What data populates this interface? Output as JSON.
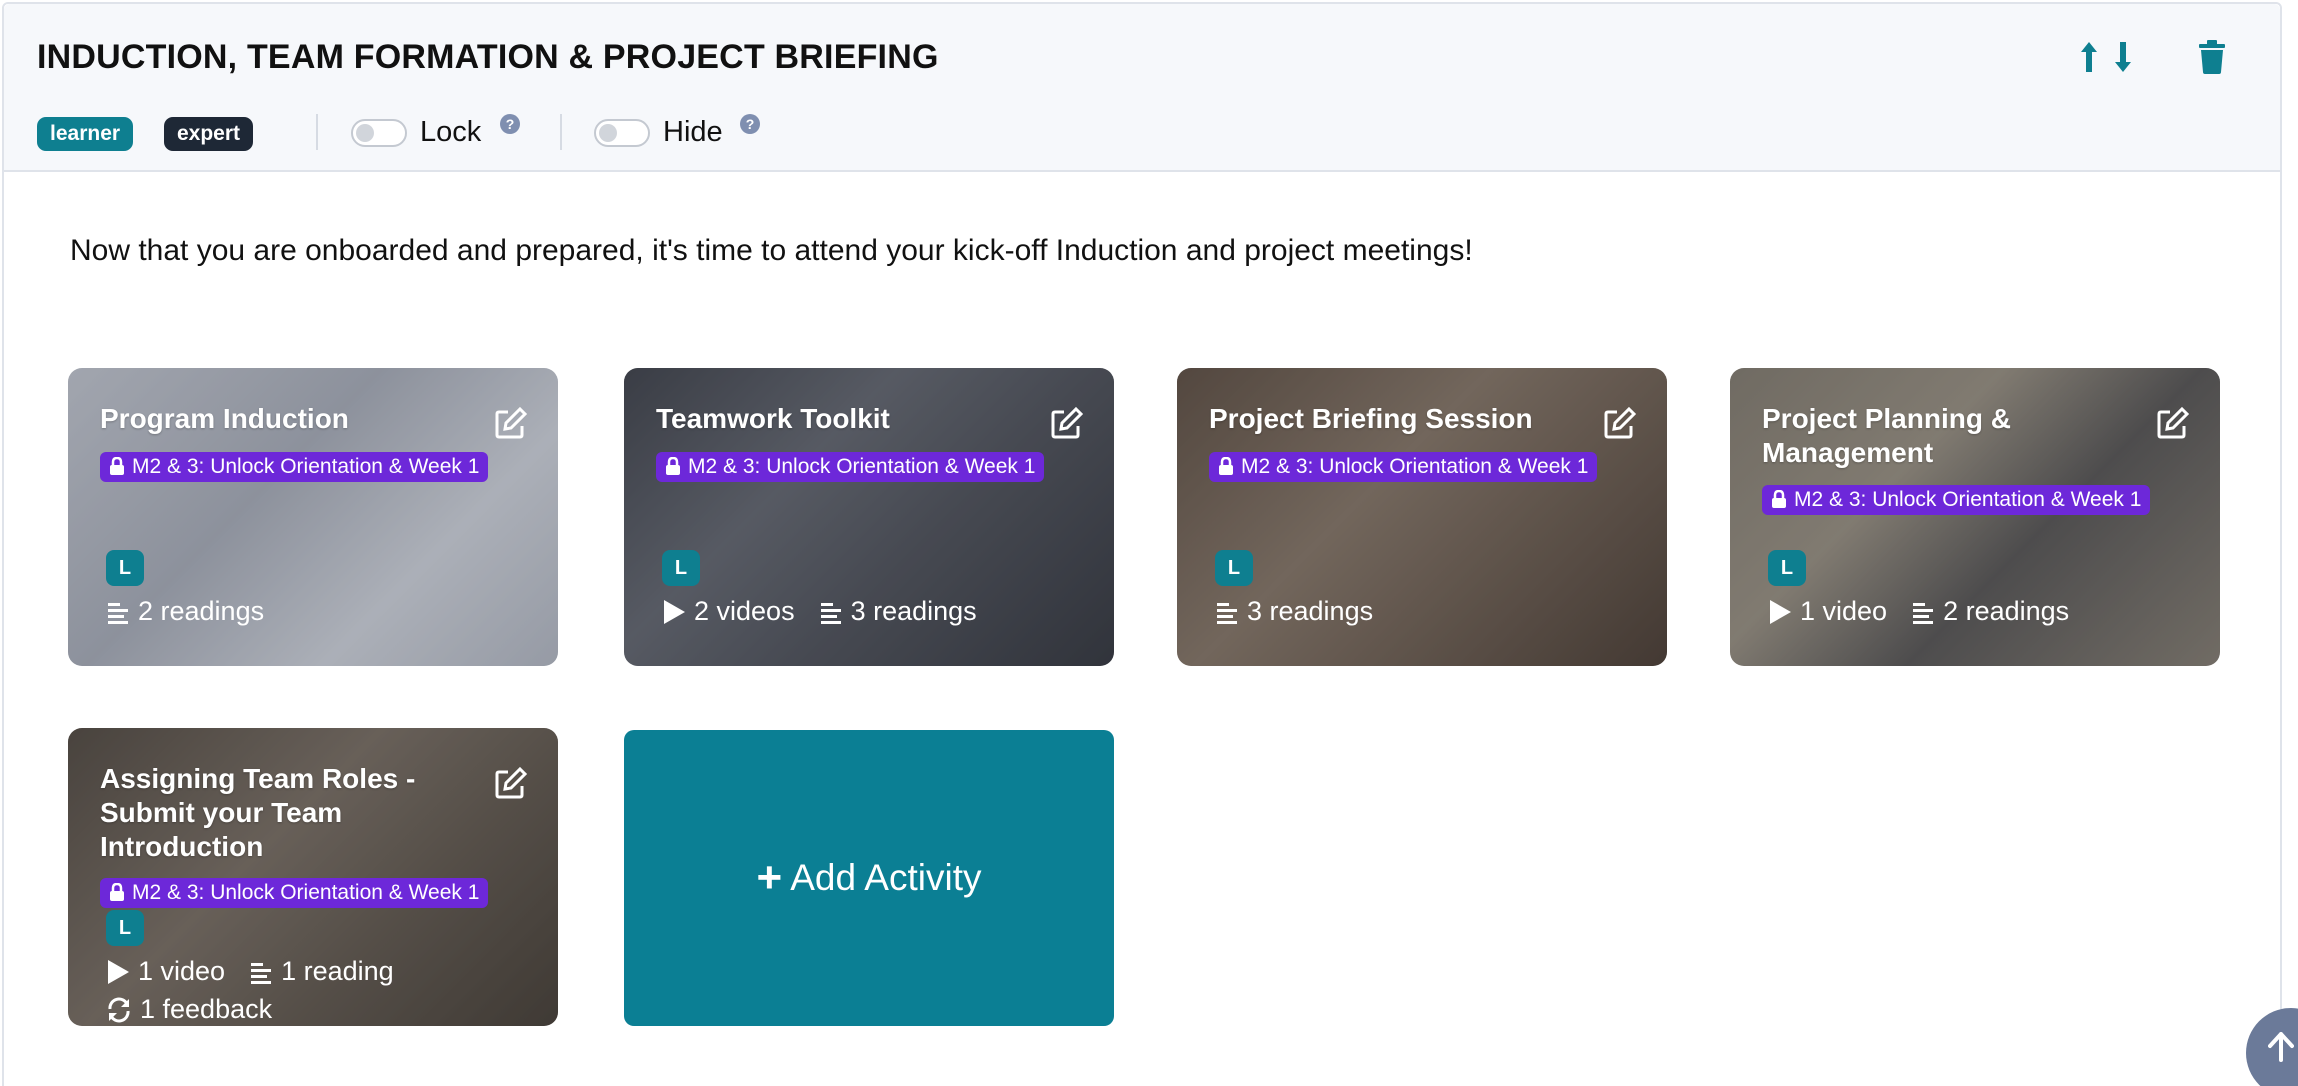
{
  "section": {
    "title": "INDUCTION, TEAM FORMATION & PROJECT BRIEFING",
    "badges": [
      "learner",
      "expert"
    ],
    "toggles": {
      "lock_label": "Lock",
      "hide_label": "Hide"
    },
    "description": "Now that you are onboarded and prepared, it's time to attend your kick-off Induction and project meetings!"
  },
  "cards": [
    {
      "title": "Program Induction",
      "lock_tag": "M2 & 3: Unlock Orientation & Week 1",
      "badge": "L",
      "readings": "2 readings"
    },
    {
      "title": "Teamwork Toolkit",
      "lock_tag": "M2 & 3: Unlock Orientation & Week 1",
      "badge": "L",
      "videos": "2 videos",
      "readings": "3 readings"
    },
    {
      "title": "Project Briefing Session",
      "lock_tag": "M2 & 3: Unlock Orientation & Week 1",
      "badge": "L",
      "readings": "3 readings"
    },
    {
      "title": "Project Planning & Management",
      "lock_tag": "M2 & 3: Unlock Orientation & Week 1",
      "badge": "L",
      "videos": "1 video",
      "readings": "2 readings"
    },
    {
      "title": "Assigning Team Roles - Submit your Team Introduction",
      "lock_tag": "M2 & 3: Unlock Orientation & Week 1",
      "badge": "L",
      "videos": "1 video",
      "readings": "1 reading",
      "feedback": "1 feedback"
    }
  ],
  "add_activity": {
    "label": "Add Activity"
  },
  "colors": {
    "teal": "#0e7f90",
    "dark": "#1e2836",
    "purple": "#6d28d9",
    "add_card": "#0b7f94"
  },
  "icons": [
    "arrow-up-icon",
    "arrow-down-icon",
    "trash-icon",
    "help-icon",
    "edit-icon",
    "lock-icon",
    "play-icon",
    "readings-icon",
    "feedback-icon",
    "plus-icon",
    "arrow-up-circle-icon"
  ]
}
